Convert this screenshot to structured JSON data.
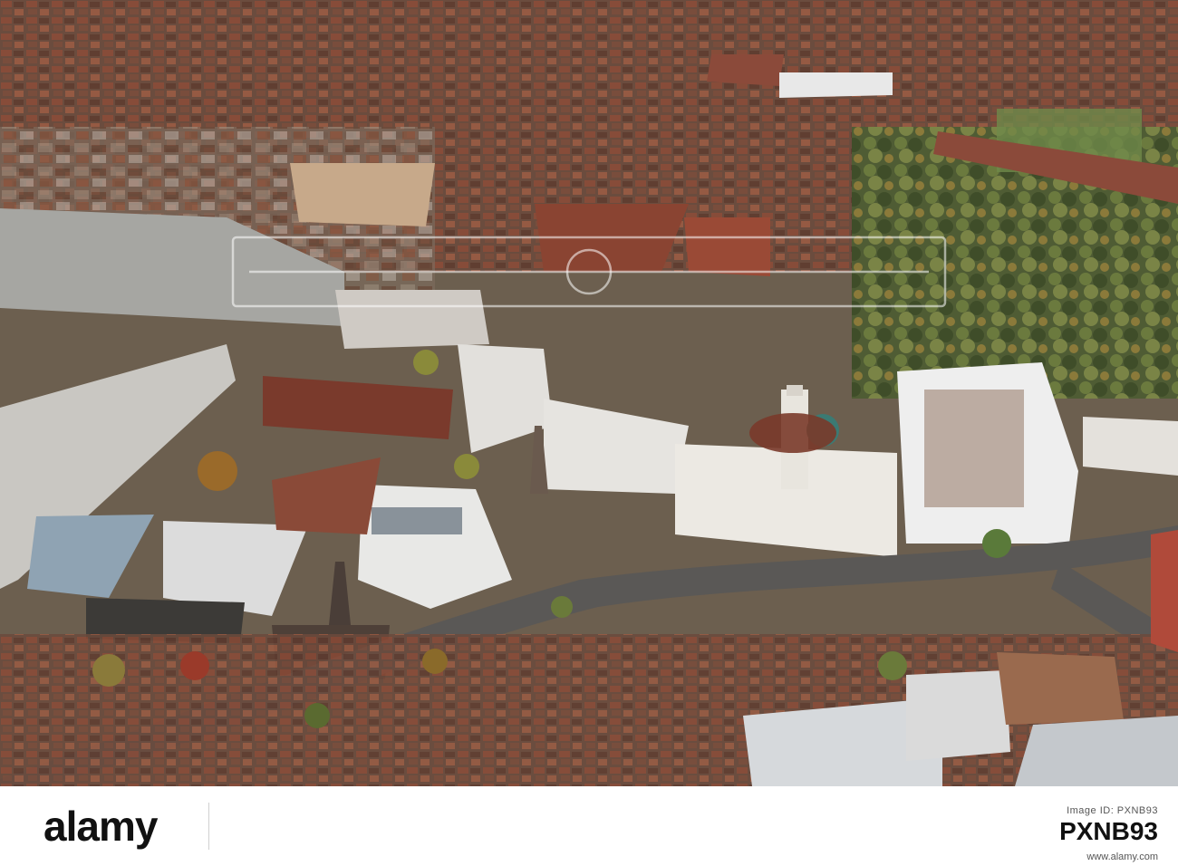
{
  "photo": {
    "subject": "aerial-view-university-campus-city"
  },
  "footer": {
    "brand_label": "alamy",
    "image_id_label": "Image ID: PXNB93",
    "image_id_value": "PXNB93",
    "site_url": "www.alamy.com"
  },
  "watermark": {
    "text": "alamy"
  },
  "colors": {
    "footer_bg": "#ffffff",
    "brand_text": "#111111"
  }
}
